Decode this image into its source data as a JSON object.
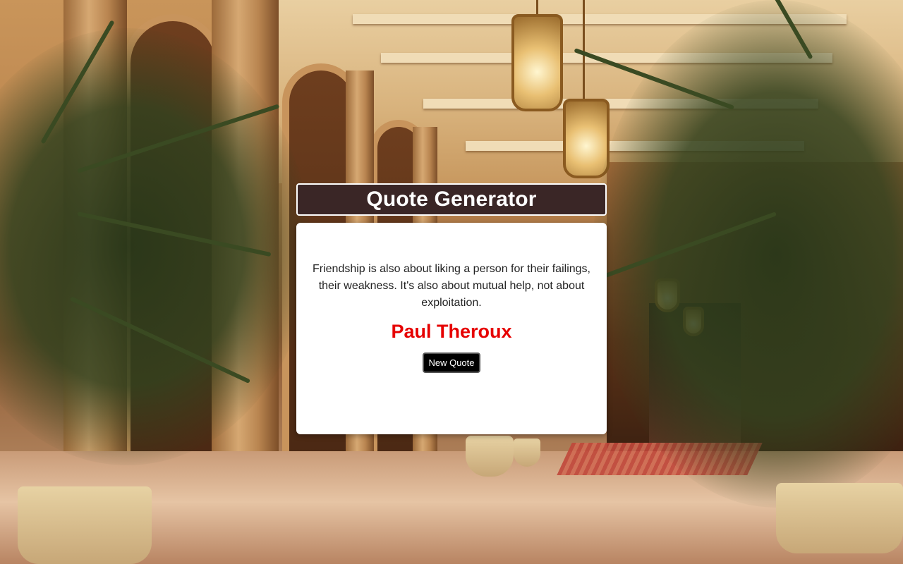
{
  "header": {
    "title": "Quote Generator"
  },
  "quote": {
    "text": "Friendship is also about liking a person for their failings, their weakness. It's also about mutual help, not about exploitation.",
    "author": "Paul Theroux",
    "button_label": "New Quote"
  },
  "colors": {
    "title_bar_bg": "#3a2626",
    "author_text": "#e60000",
    "button_bg": "#000000",
    "card_bg": "#ffffff"
  },
  "background": {
    "description_icon": "hotel-lobby-background-image"
  }
}
